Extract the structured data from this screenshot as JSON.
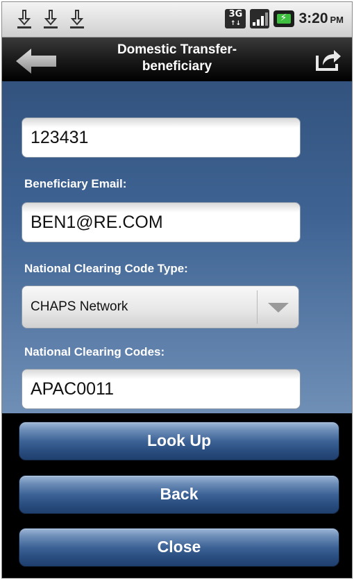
{
  "status_bar": {
    "network": "3G",
    "network_sub": "↑↓",
    "time": "3:20",
    "ampm": "PM",
    "icons": [
      "download-icon",
      "download-icon",
      "download-icon",
      "3g-icon",
      "signal-icon",
      "battery-charging-icon"
    ]
  },
  "header": {
    "title_line1": "Domestic Transfer-",
    "title_line2": "beneficiary"
  },
  "form": {
    "account_value": "123431",
    "email_label": "Beneficiary Email:",
    "email_value": "BEN1@RE.COM",
    "clearing_type_label": "National Clearing Code Type:",
    "clearing_type_value": "CHAPS Network",
    "clearing_codes_label": "National Clearing Codes:",
    "clearing_codes_value": "APAC0011"
  },
  "buttons": {
    "lookup": "Look Up",
    "back": "Back",
    "close": "Close"
  },
  "colors": {
    "content_bg": "#3e6393",
    "button_bg": "#2a4e80",
    "label_text": "#ffffff"
  }
}
